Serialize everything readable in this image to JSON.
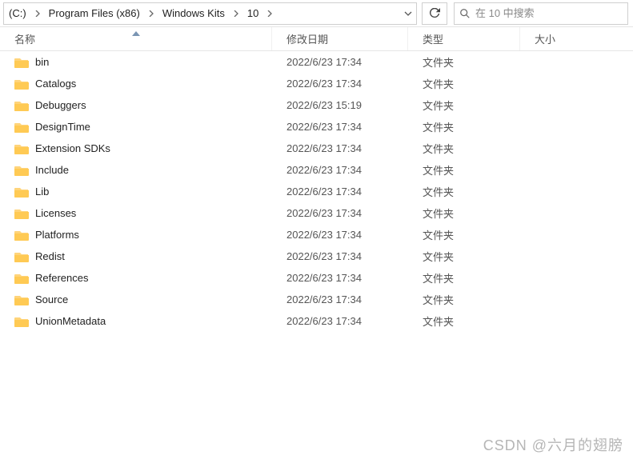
{
  "breadcrumb": {
    "root": "(C:)",
    "seg1": "Program Files (x86)",
    "seg2": "Windows Kits",
    "seg3": "10"
  },
  "search": {
    "placeholder": "在 10 中搜索"
  },
  "columns": {
    "name": "名称",
    "date": "修改日期",
    "type": "类型",
    "size": "大小"
  },
  "type_folder": "文件夹",
  "items": [
    {
      "name": "bin",
      "date": "2022/6/23 17:34"
    },
    {
      "name": "Catalogs",
      "date": "2022/6/23 17:34"
    },
    {
      "name": "Debuggers",
      "date": "2022/6/23 15:19"
    },
    {
      "name": "DesignTime",
      "date": "2022/6/23 17:34"
    },
    {
      "name": "Extension SDKs",
      "date": "2022/6/23 17:34"
    },
    {
      "name": "Include",
      "date": "2022/6/23 17:34"
    },
    {
      "name": "Lib",
      "date": "2022/6/23 17:34"
    },
    {
      "name": "Licenses",
      "date": "2022/6/23 17:34"
    },
    {
      "name": "Platforms",
      "date": "2022/6/23 17:34"
    },
    {
      "name": "Redist",
      "date": "2022/6/23 17:34"
    },
    {
      "name": "References",
      "date": "2022/6/23 17:34"
    },
    {
      "name": "Source",
      "date": "2022/6/23 17:34"
    },
    {
      "name": "UnionMetadata",
      "date": "2022/6/23 17:34"
    }
  ],
  "watermark": "CSDN @六月的翅膀"
}
